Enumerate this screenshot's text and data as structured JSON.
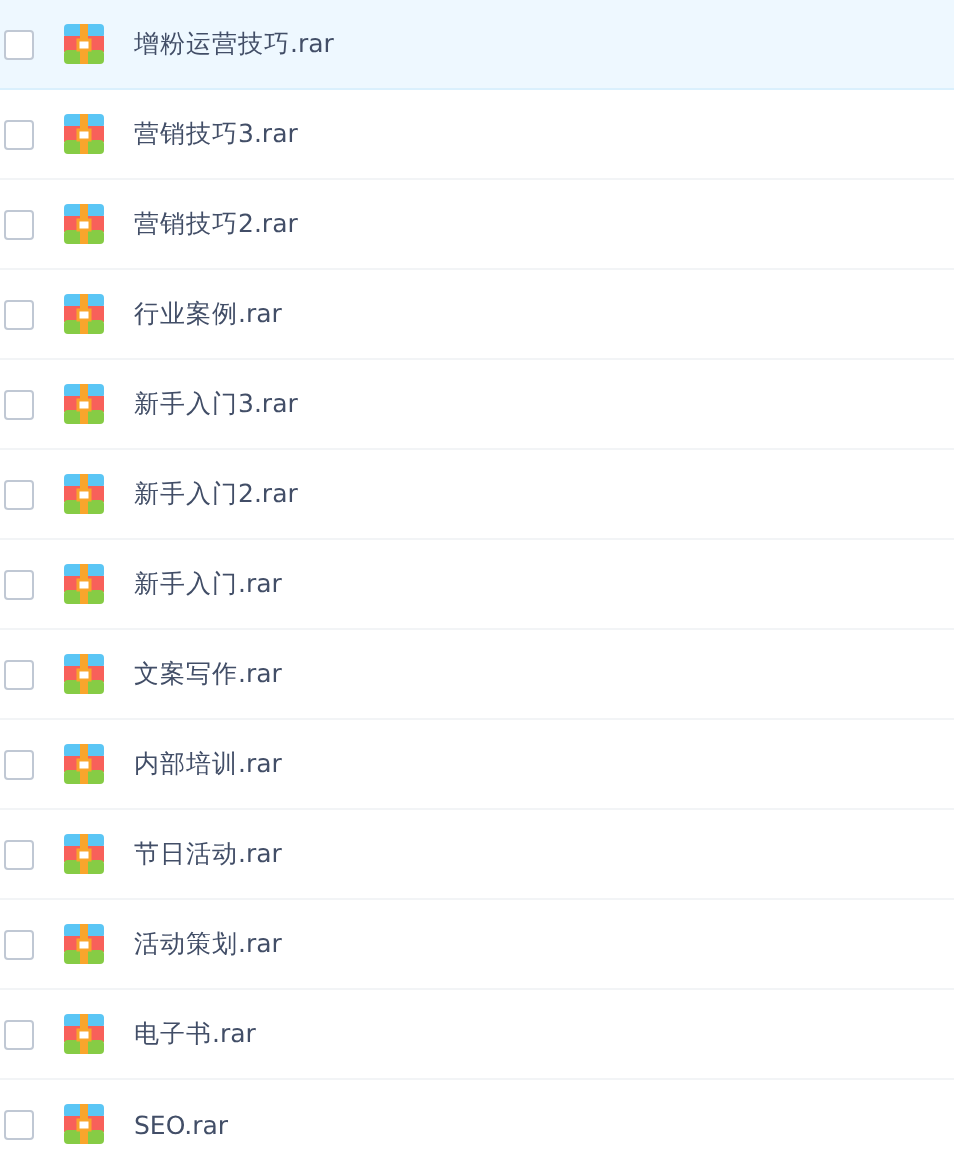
{
  "files": [
    {
      "name": "增粉运营技巧.rar",
      "selected": true,
      "checked": false
    },
    {
      "name": "营销技巧3.rar",
      "selected": false,
      "checked": false
    },
    {
      "name": "营销技巧2.rar",
      "selected": false,
      "checked": false
    },
    {
      "name": "行业案例.rar",
      "selected": false,
      "checked": false
    },
    {
      "name": "新手入门3.rar",
      "selected": false,
      "checked": false
    },
    {
      "name": "新手入门2.rar",
      "selected": false,
      "checked": false
    },
    {
      "name": "新手入门.rar",
      "selected": false,
      "checked": false
    },
    {
      "name": "文案写作.rar",
      "selected": false,
      "checked": false
    },
    {
      "name": "内部培训.rar",
      "selected": false,
      "checked": false
    },
    {
      "name": "节日活动.rar",
      "selected": false,
      "checked": false
    },
    {
      "name": "活动策划.rar",
      "selected": false,
      "checked": false
    },
    {
      "name": "电子书.rar",
      "selected": false,
      "checked": false
    },
    {
      "name": "SEO.rar",
      "selected": false,
      "checked": false
    }
  ]
}
